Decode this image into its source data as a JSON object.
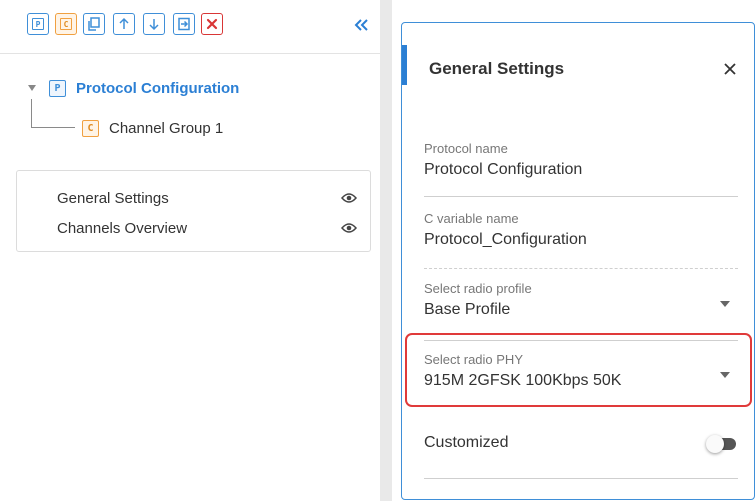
{
  "toolbar": {
    "buttons": [
      {
        "icon": "protocol-icon",
        "glyph": "P"
      },
      {
        "icon": "channel-group-icon",
        "glyph": "C"
      },
      {
        "icon": "copy-icon"
      },
      {
        "icon": "arrow-up-icon"
      },
      {
        "icon": "arrow-down-icon"
      },
      {
        "icon": "import-icon"
      },
      {
        "icon": "delete-icon"
      }
    ],
    "collapse_icon": "double-chevron-left-icon"
  },
  "tree": {
    "root": {
      "badge": "P",
      "label": "Protocol Configuration"
    },
    "child": {
      "badge": "C",
      "label": "Channel Group 1"
    }
  },
  "views": [
    {
      "label": "General Settings",
      "icon": "eye-icon"
    },
    {
      "label": "Channels Overview",
      "icon": "eye-icon"
    }
  ],
  "settings": {
    "title": "General Settings",
    "close_icon": "close-icon",
    "fields": [
      {
        "label": "Protocol name",
        "value": "Protocol Configuration"
      },
      {
        "label": "C variable name",
        "value": "Protocol_Configuration"
      },
      {
        "label": "Select radio profile",
        "value": "Base Profile"
      },
      {
        "label": "Select radio PHY",
        "value": "915M 2GFSK 100Kbps 50K"
      }
    ],
    "toggle": {
      "label": "Customized",
      "on": false
    }
  },
  "colors": {
    "accent": "#2b7fd4",
    "channel": "#f0a040",
    "danger": "#d93636",
    "highlight": "#e03a3a"
  }
}
